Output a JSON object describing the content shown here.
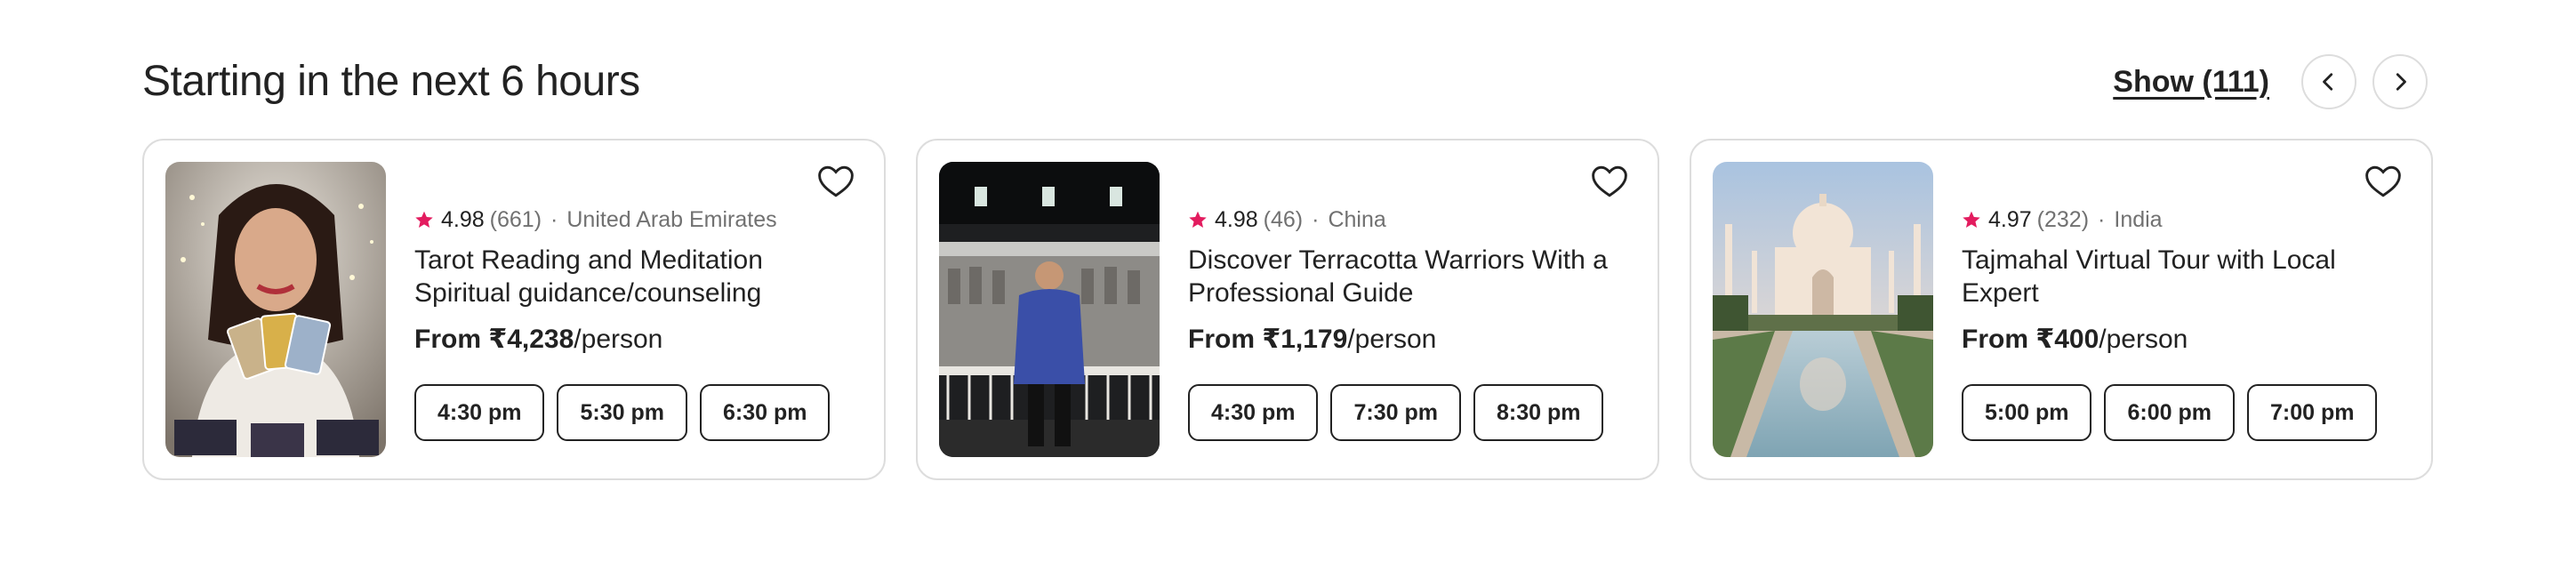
{
  "section": {
    "title": "Starting in the next 6 hours",
    "show_label": "Show (111)"
  },
  "nav": {
    "prev_icon": "chevron-left-icon",
    "next_icon": "chevron-right-icon"
  },
  "colors": {
    "star": "#E31C5F",
    "text": "#222222",
    "muted": "#717171",
    "border": "#DDDDDD"
  },
  "cards": [
    {
      "image": "woman-holding-tarot-cards",
      "rating": "4.98",
      "reviews": "(661)",
      "separator": "·",
      "location": "United Arab Emirates",
      "title": "Tarot Reading and Meditation Spiritual guidance/counseling",
      "price_prefix": "From ",
      "price_amount": "₹4,238",
      "price_suffix": "/person",
      "slots": [
        "4:30 pm",
        "5:30 pm",
        "6:30 pm"
      ]
    },
    {
      "image": "guide-at-terracotta-warriors",
      "rating": "4.98",
      "reviews": "(46)",
      "separator": "·",
      "location": "China",
      "title": "Discover Terracotta Warriors With a Professional Guide",
      "price_prefix": "From ",
      "price_amount": "₹1,179",
      "price_suffix": "/person",
      "slots": [
        "4:30 pm",
        "7:30 pm",
        "8:30 pm"
      ]
    },
    {
      "image": "taj-mahal-reflection",
      "rating": "4.97",
      "reviews": "(232)",
      "separator": "·",
      "location": "India",
      "title": "Tajmahal Virtual Tour with Local Expert",
      "price_prefix": "From ",
      "price_amount": "₹400",
      "price_suffix": "/person",
      "slots": [
        "5:00 pm",
        "6:00 pm",
        "7:00 pm"
      ]
    }
  ]
}
